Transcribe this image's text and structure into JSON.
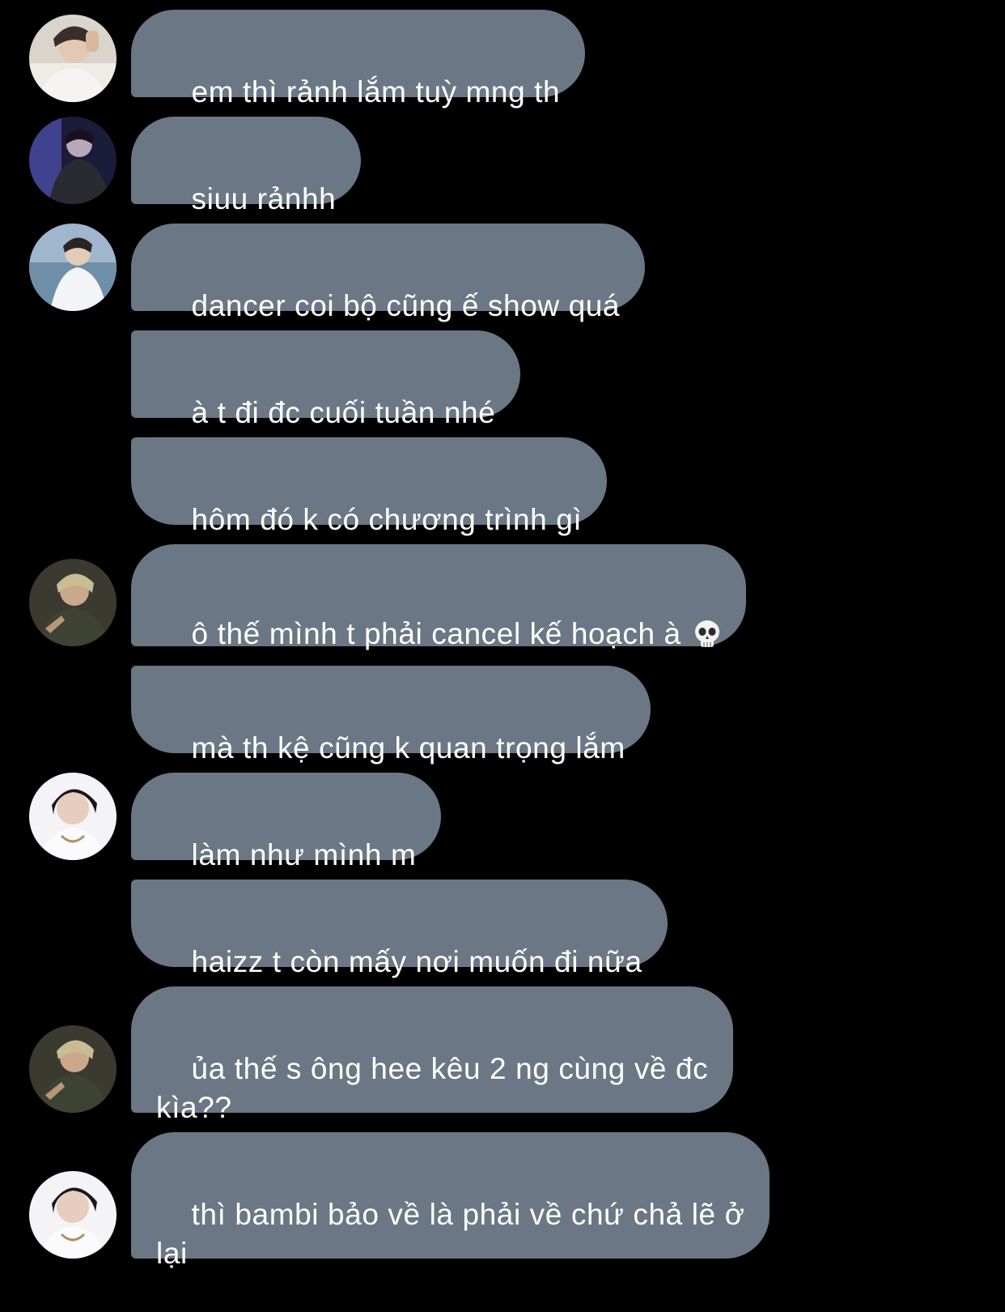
{
  "conversation": {
    "messages": [
      {
        "text": "em thì rảnh lắm tuỳ mng th",
        "avatar": "avatar-1"
      },
      {
        "text": "siuu rảnhh",
        "avatar": "avatar-2"
      },
      {
        "text": "dancer coi bộ cũng ế show quá",
        "avatar": "avatar-3"
      },
      {
        "text": "à t đi đc cuối tuần nhé",
        "avatar": null
      },
      {
        "text": "hôm đó k có chương trình gì",
        "avatar": null
      },
      {
        "text": "ô thế mình t phải cancel kế hoạch à ",
        "emoji": "skull-emoji",
        "avatar": "avatar-4"
      },
      {
        "text": "mà th kệ cũng k quan trọng lắm",
        "avatar": null
      },
      {
        "text": "làm như mình m",
        "avatar": "avatar-5"
      },
      {
        "text": "haizz t còn mấy nơi muốn đi nữa",
        "avatar": null
      },
      {
        "text": "ủa thế s ông hee kêu 2 ng cùng về đc\nkìa??",
        "avatar": "avatar-4"
      },
      {
        "text": "thì bambi bảo về là phải về chứ chả lẽ ở\nlại",
        "avatar": "avatar-5"
      }
    ]
  },
  "colors": {
    "background": "#000000",
    "bubble": "#6b7785",
    "text": "#ffffff"
  }
}
